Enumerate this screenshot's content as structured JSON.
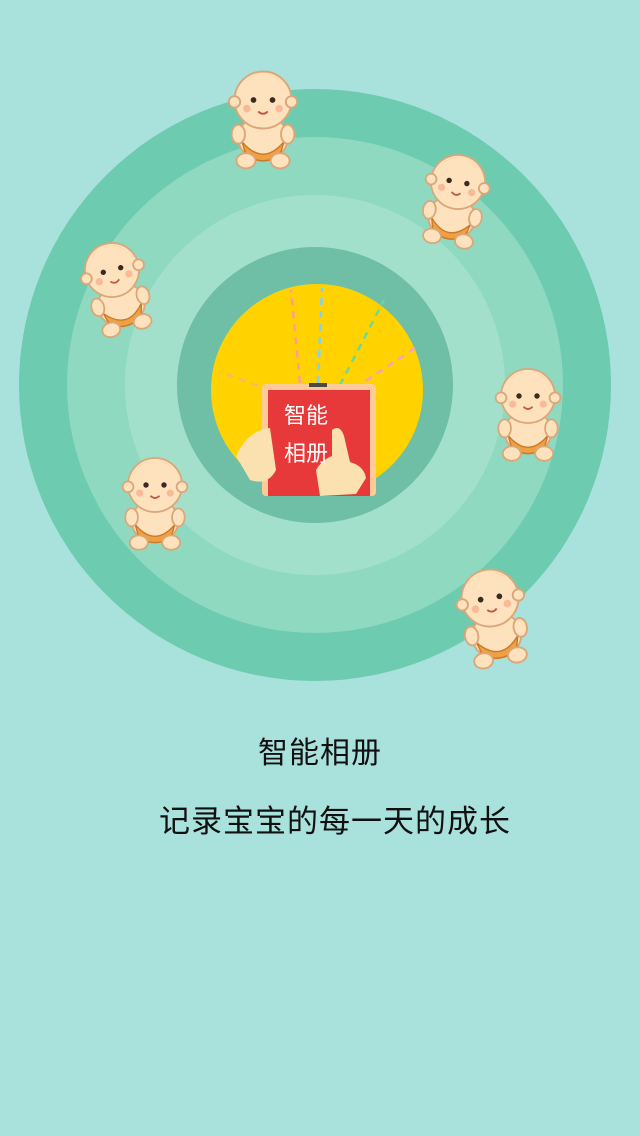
{
  "intro": {
    "title": "智能相册",
    "subtitle": "记录宝宝的每一天的成长"
  },
  "badge": {
    "line1": "智能",
    "line2": "相册"
  },
  "colors": {
    "background": "#a9e1dd",
    "outer_ring": "#6dcbaf",
    "middle_ring": "#8fd9c1",
    "inner_ring": "#6fbfa6",
    "center_disc": "#ffd200",
    "tablet": "#e8393a",
    "diaper": "#f0a040",
    "skin": "#fde2bd"
  },
  "icons": [
    "baby-icon",
    "tablet-icon",
    "hand-icon"
  ]
}
